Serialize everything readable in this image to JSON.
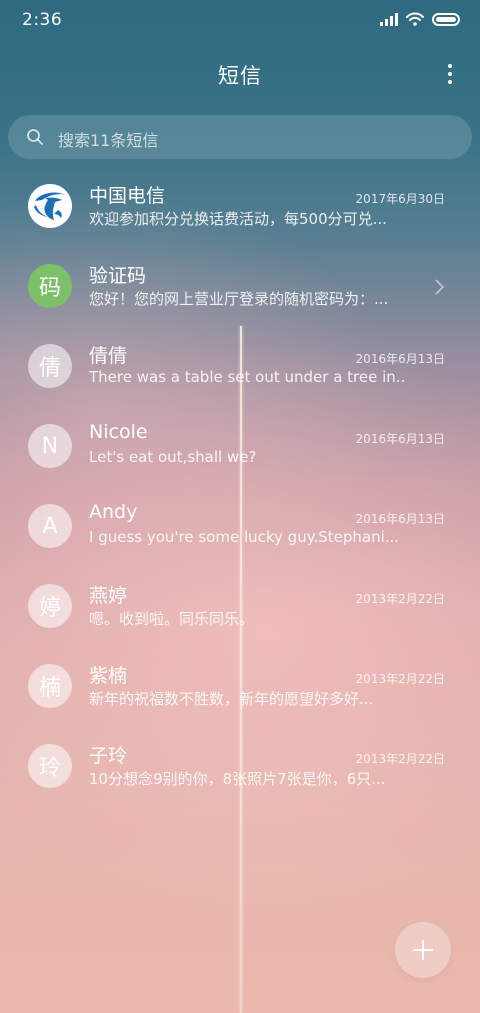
{
  "status_bar": {
    "time": "2:36",
    "icons": [
      "signal-icon",
      "wifi-icon",
      "battery-icon"
    ]
  },
  "header": {
    "title": "短信",
    "menu_icon": "more-vertical-icon"
  },
  "search": {
    "placeholder": "搜索11条短信",
    "icon": "search-icon"
  },
  "conversations": [
    {
      "avatar_type": "logo",
      "avatar_text": "",
      "name": "中国电信",
      "date": "2017年6月30日",
      "preview": "欢迎参加积分兑换话费活动，每500分可兑..."
    },
    {
      "avatar_type": "green",
      "avatar_text": "码",
      "name": "验证码",
      "date": "",
      "preview": "您好！您的网上营业厅登录的随机密码为：..."
    },
    {
      "avatar_type": "plain",
      "avatar_text": "倩",
      "name": "倩倩",
      "date": "2016年6月13日",
      "preview": "There was a table set out under a tree in..."
    },
    {
      "avatar_type": "plain",
      "avatar_text": "N",
      "name": "Nicole",
      "date": "2016年6月13日",
      "preview": "Let's eat out,shall we?"
    },
    {
      "avatar_type": "plain",
      "avatar_text": "A",
      "name": "Andy",
      "date": "2016年6月13日",
      "preview": "I guess you're some lucky guy.Stephani..."
    },
    {
      "avatar_type": "plain",
      "avatar_text": "婷",
      "name": "燕婷",
      "date": "2013年2月22日",
      "preview": "嗯。收到啦。同乐同乐。"
    },
    {
      "avatar_type": "plain",
      "avatar_text": "楠",
      "name": "紫楠",
      "date": "2013年2月22日",
      "preview": "新年的祝福数不胜数，新年的愿望好多好..."
    },
    {
      "avatar_type": "plain",
      "avatar_text": "玲",
      "name": "子玲",
      "date": "2013年2月22日",
      "preview": "10分想念9别的你，8张照片7张是你，6只..."
    }
  ],
  "fab": {
    "icon": "plus-icon"
  },
  "colors": {
    "sky_top": "#2e6a80",
    "sky_bottom": "#eab9ad",
    "verification_avatar": "#7cc06a",
    "telecom_blue": "#1b6fb5"
  }
}
